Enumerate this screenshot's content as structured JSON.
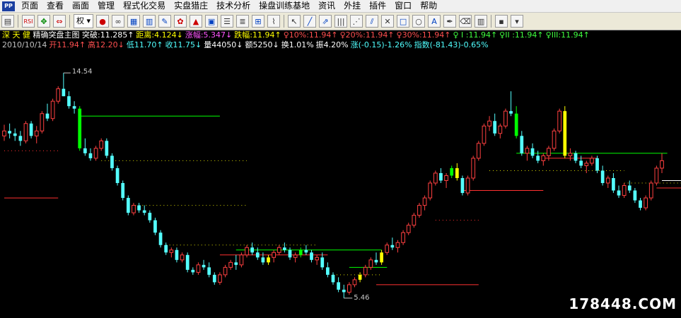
{
  "menubar": {
    "logo_text": "PP",
    "items": [
      "页面",
      "查看",
      "画面",
      "管理",
      "程式化交易",
      "实盘猎庄",
      "技术分析",
      "操盘训练基地",
      "资讯",
      "外挂",
      "插件",
      "窗口",
      "帮助"
    ]
  },
  "toolbar": {
    "period_select": "权",
    "icons": [
      "folder-icon",
      "rsi-icon",
      "move-icon",
      "arrows-icon",
      "period-select",
      "circle-icon",
      "glasses-icon",
      "doc-icon",
      "book-icon",
      "pen-icon",
      "brush-icon",
      "bell-icon",
      "box-icon",
      "menu-icon",
      "list-icon",
      "grid-icon",
      "chart-icon",
      "cursor-icon",
      "line-icon",
      "trend-icon",
      "bars-icon",
      "fan-icon",
      "channel-icon",
      "cross-icon",
      "rect-icon",
      "ellipse-icon",
      "text-icon",
      "marker-icon",
      "eraser-icon",
      "bars2-icon",
      "save-icon",
      "dropdown-icon"
    ]
  },
  "stock": {
    "name": "深 天 健",
    "indicator": "精确突盘主图",
    "line1": [
      {
        "text": "突破:11.285↑",
        "color": "w"
      },
      {
        "text": "距离:4.124↓",
        "color": "y"
      },
      {
        "text": "涨幅:5.347↓",
        "color": "m"
      },
      {
        "text": "跌幅:11.94↑",
        "color": "y"
      },
      {
        "text": "♀10%:11.94↑",
        "color": "r"
      },
      {
        "text": "♀20%:11.94↑",
        "color": "r"
      },
      {
        "text": "♀30%:11.94↑",
        "color": "r"
      },
      {
        "text": "♀ I :11.94↑",
        "color": "g"
      },
      {
        "text": "♀II :11.94↑",
        "color": "g"
      },
      {
        "text": "♀III:11.94↑",
        "color": "g"
      }
    ],
    "line2": [
      {
        "text": "2010/10/14",
        "color": "gr"
      },
      {
        "text": "开11.94↑",
        "color": "r"
      },
      {
        "text": "高12.20↓",
        "color": "r"
      },
      {
        "text": "低11.70↑",
        "color": "c"
      },
      {
        "text": "收11.75↓",
        "color": "c"
      },
      {
        "text": "量44050↓",
        "color": "w"
      },
      {
        "text": "额5250↓",
        "color": "w"
      },
      {
        "text": "换1.01%",
        "color": "w"
      },
      {
        "text": "振4.20%",
        "color": "w"
      },
      {
        "text": "涨(-0.15)-1.26%",
        "color": "c"
      },
      {
        "text": "指数(-81.43)-0.65%",
        "color": "c"
      }
    ]
  },
  "chart": {
    "high_label": "14.54",
    "low_label": "5.46"
  },
  "chart_data": {
    "type": "candlestick",
    "ylim": [
      5.0,
      15.4
    ],
    "high_point": 14.54,
    "low_point": 5.46,
    "colors": {
      "up": "#ff4040",
      "down": "#54ffff",
      "signal_green": "#00ff00",
      "signal_yellow": "#ffff00"
    },
    "candles": [
      [
        12.0,
        12.45,
        11.8,
        12.2
      ],
      [
        12.2,
        12.5,
        11.9,
        12.1
      ],
      [
        12.1,
        12.3,
        11.8,
        12.0
      ],
      [
        12.0,
        12.2,
        11.6,
        11.8
      ],
      [
        11.8,
        12.6,
        11.7,
        12.5
      ],
      [
        12.5,
        12.6,
        11.9,
        12.0
      ],
      [
        12.0,
        12.4,
        11.7,
        12.2
      ],
      [
        12.2,
        13.0,
        12.1,
        12.9
      ],
      [
        12.9,
        13.3,
        12.6,
        12.7
      ],
      [
        12.7,
        13.5,
        12.6,
        13.4
      ],
      [
        13.4,
        14.0,
        13.3,
        13.9
      ],
      [
        13.9,
        14.54,
        13.6,
        13.6
      ],
      [
        13.6,
        13.8,
        13.1,
        13.2
      ],
      [
        13.2,
        13.4,
        12.9,
        13.1
      ],
      [
        13.1,
        13.2,
        11.4,
        11.5
      ],
      [
        11.5,
        11.9,
        11.2,
        11.3
      ],
      [
        11.3,
        11.5,
        11.0,
        11.1
      ],
      [
        11.1,
        11.6,
        11.0,
        11.5
      ],
      [
        11.5,
        11.9,
        11.4,
        11.8
      ],
      [
        11.8,
        11.9,
        11.1,
        11.2
      ],
      [
        11.2,
        11.3,
        10.6,
        10.7
      ],
      [
        10.7,
        10.8,
        10.0,
        10.1
      ],
      [
        10.1,
        10.2,
        9.4,
        9.5
      ],
      [
        9.5,
        9.6,
        8.8,
        8.9
      ],
      [
        8.9,
        9.3,
        8.8,
        9.2
      ],
      [
        9.2,
        9.3,
        8.9,
        9.0
      ],
      [
        9.0,
        9.2,
        8.8,
        8.9
      ],
      [
        8.9,
        9.0,
        8.5,
        8.6
      ],
      [
        8.6,
        8.7,
        8.0,
        8.1
      ],
      [
        8.1,
        8.2,
        7.5,
        7.6
      ],
      [
        7.6,
        7.7,
        7.2,
        7.3
      ],
      [
        7.3,
        7.5,
        7.1,
        7.4
      ],
      [
        7.4,
        7.5,
        6.9,
        7.0
      ],
      [
        7.0,
        7.3,
        6.9,
        7.2
      ],
      [
        7.2,
        7.3,
        6.5,
        6.6
      ],
      [
        6.6,
        6.7,
        6.4,
        6.5
      ],
      [
        6.5,
        6.9,
        6.4,
        6.8
      ],
      [
        6.8,
        7.0,
        6.6,
        6.7
      ],
      [
        6.7,
        6.9,
        6.3,
        6.4
      ],
      [
        6.4,
        6.5,
        6.0,
        6.1
      ],
      [
        6.1,
        6.5,
        6.0,
        6.4
      ],
      [
        6.4,
        6.8,
        6.3,
        6.7
      ],
      [
        6.7,
        7.0,
        6.6,
        6.9
      ],
      [
        6.9,
        7.2,
        6.6,
        6.8
      ],
      [
        6.8,
        7.3,
        6.7,
        7.2
      ],
      [
        7.2,
        7.6,
        7.1,
        7.5
      ],
      [
        7.5,
        7.7,
        7.2,
        7.3
      ],
      [
        7.3,
        7.5,
        7.0,
        7.1
      ],
      [
        7.1,
        7.3,
        6.8,
        6.9
      ],
      [
        6.9,
        7.2,
        6.8,
        7.1
      ],
      [
        7.1,
        7.4,
        6.9,
        7.3
      ],
      [
        7.3,
        7.6,
        7.2,
        7.5
      ],
      [
        7.5,
        7.7,
        7.3,
        7.4
      ],
      [
        7.4,
        7.5,
        7.0,
        7.1
      ],
      [
        7.1,
        7.3,
        6.9,
        7.2
      ],
      [
        7.2,
        7.5,
        7.1,
        7.4
      ],
      [
        7.4,
        7.6,
        7.2,
        7.3
      ],
      [
        7.3,
        7.4,
        6.9,
        7.0
      ],
      [
        7.0,
        7.2,
        6.8,
        7.1
      ],
      [
        7.1,
        7.3,
        6.6,
        6.7
      ],
      [
        6.7,
        6.9,
        6.3,
        6.4
      ],
      [
        6.4,
        6.5,
        6.0,
        6.1
      ],
      [
        6.1,
        6.3,
        5.7,
        5.8
      ],
      [
        5.8,
        6.0,
        5.46,
        5.7
      ],
      [
        5.7,
        6.1,
        5.6,
        6.0
      ],
      [
        6.0,
        6.3,
        5.9,
        6.2
      ],
      [
        6.2,
        6.5,
        6.1,
        6.4
      ],
      [
        6.4,
        6.8,
        6.3,
        6.7
      ],
      [
        6.7,
        7.1,
        6.6,
        7.0
      ],
      [
        7.0,
        7.3,
        6.8,
        6.9
      ],
      [
        6.9,
        7.4,
        6.8,
        7.3
      ],
      [
        7.3,
        7.7,
        7.2,
        7.6
      ],
      [
        7.6,
        7.9,
        7.4,
        7.5
      ],
      [
        7.5,
        7.8,
        7.3,
        7.7
      ],
      [
        7.7,
        8.2,
        7.6,
        8.1
      ],
      [
        8.1,
        8.5,
        8.0,
        8.4
      ],
      [
        8.4,
        8.9,
        8.3,
        8.8
      ],
      [
        8.8,
        9.3,
        8.7,
        9.2
      ],
      [
        9.2,
        9.6,
        9.0,
        9.5
      ],
      [
        9.5,
        10.2,
        9.4,
        10.1
      ],
      [
        10.1,
        10.6,
        10.0,
        10.5
      ],
      [
        10.5,
        10.7,
        10.1,
        10.2
      ],
      [
        10.2,
        10.5,
        9.9,
        10.4
      ],
      [
        10.4,
        10.8,
        10.3,
        10.7
      ],
      [
        10.7,
        10.9,
        10.2,
        10.3
      ],
      [
        10.3,
        10.4,
        9.6,
        9.7
      ],
      [
        9.7,
        10.4,
        9.6,
        10.3
      ],
      [
        10.3,
        11.2,
        10.2,
        11.1
      ],
      [
        11.1,
        11.8,
        11.0,
        11.7
      ],
      [
        11.7,
        12.5,
        11.6,
        12.4
      ],
      [
        12.4,
        12.8,
        12.2,
        12.6
      ],
      [
        12.6,
        12.9,
        12.0,
        12.1
      ],
      [
        12.1,
        12.5,
        11.9,
        12.4
      ],
      [
        12.4,
        13.1,
        12.3,
        13.0
      ],
      [
        13.0,
        13.8,
        12.8,
        12.9
      ],
      [
        12.9,
        13.2,
        11.9,
        12.0
      ],
      [
        12.0,
        12.2,
        11.2,
        11.3
      ],
      [
        11.3,
        11.6,
        11.0,
        11.5
      ],
      [
        11.5,
        11.7,
        11.1,
        11.2
      ],
      [
        11.2,
        11.4,
        10.9,
        11.0
      ],
      [
        11.0,
        11.3,
        10.8,
        11.2
      ],
      [
        11.2,
        11.6,
        11.0,
        11.5
      ],
      [
        11.5,
        12.3,
        11.4,
        12.2
      ],
      [
        12.2,
        13.1,
        12.1,
        13.0
      ],
      [
        13.0,
        13.2,
        11.1,
        11.2
      ],
      [
        11.2,
        11.5,
        11.0,
        11.3
      ],
      [
        11.3,
        11.4,
        10.9,
        11.0
      ],
      [
        11.0,
        11.2,
        10.7,
        10.8
      ],
      [
        10.8,
        11.0,
        10.5,
        10.9
      ],
      [
        10.9,
        11.2,
        10.8,
        11.1
      ],
      [
        11.1,
        11.2,
        10.5,
        10.6
      ],
      [
        10.6,
        10.8,
        10.0,
        10.1
      ],
      [
        10.1,
        10.4,
        9.9,
        10.3
      ],
      [
        10.3,
        10.5,
        9.7,
        9.8
      ],
      [
        9.8,
        10.0,
        9.5,
        9.6
      ],
      [
        9.6,
        10.1,
        9.5,
        10.0
      ],
      [
        10.0,
        10.2,
        9.7,
        9.8
      ],
      [
        9.8,
        9.9,
        9.3,
        9.4
      ],
      [
        9.4,
        9.5,
        9.0,
        9.1
      ],
      [
        9.1,
        9.6,
        9.0,
        9.5
      ],
      [
        9.5,
        10.2,
        9.4,
        10.1
      ],
      [
        10.1,
        10.8,
        10.0,
        10.7
      ],
      [
        10.7,
        11.3,
        10.5,
        11.0
      ]
    ],
    "signal_bars": [
      {
        "index": 14,
        "color": "green"
      },
      {
        "index": 49,
        "color": "yellow"
      },
      {
        "index": 55,
        "color": "green"
      },
      {
        "index": 66,
        "color": "yellow"
      },
      {
        "index": 70,
        "color": "yellow"
      },
      {
        "index": 83,
        "color": "green"
      },
      {
        "index": 84,
        "color": "yellow"
      },
      {
        "index": 95,
        "color": "green"
      },
      {
        "index": 104,
        "color": "yellow"
      },
      {
        "index": 125,
        "color": "yellow"
      }
    ],
    "level_lines": [
      {
        "value": 12.8,
        "from": 14,
        "to": 40,
        "color": "green",
        "style": "solid"
      },
      {
        "value": 11.4,
        "from": 0,
        "to": 10,
        "color": "red",
        "style": "dotted"
      },
      {
        "value": 11.0,
        "from": 18,
        "to": 45,
        "color": "yellow",
        "style": "dotted"
      },
      {
        "value": 9.5,
        "from": 0,
        "to": 10,
        "color": "red",
        "style": "solid"
      },
      {
        "value": 9.2,
        "from": 23,
        "to": 45,
        "color": "yellow",
        "style": "dotted"
      },
      {
        "value": 7.6,
        "from": 30,
        "to": 58,
        "color": "yellow",
        "style": "dotted"
      },
      {
        "value": 7.4,
        "from": 43,
        "to": 70,
        "color": "green",
        "style": "solid"
      },
      {
        "value": 7.2,
        "from": 40,
        "to": 60,
        "color": "red",
        "style": "solid"
      },
      {
        "value": 6.4,
        "from": 61,
        "to": 70,
        "color": "yellow",
        "style": "dotted"
      },
      {
        "value": 6.7,
        "from": 64,
        "to": 71,
        "color": "green",
        "style": "solid"
      },
      {
        "value": 6.0,
        "from": 69,
        "to": 88,
        "color": "red",
        "style": "solid"
      },
      {
        "value": 8.6,
        "from": 80,
        "to": 88,
        "color": "red",
        "style": "dotted"
      },
      {
        "value": 9.8,
        "from": 85,
        "to": 100,
        "color": "red",
        "style": "solid"
      },
      {
        "value": 10.6,
        "from": 90,
        "to": 115,
        "color": "yellow",
        "style": "dotted"
      },
      {
        "value": 11.3,
        "from": 95,
        "to": 123,
        "color": "green",
        "style": "solid"
      },
      {
        "value": 11.1,
        "from": 100,
        "to": 110,
        "color": "red",
        "style": "solid"
      },
      {
        "value": 10.1,
        "from": 115,
        "to": 127,
        "color": "yellow",
        "style": "dotted"
      },
      {
        "value": 9.9,
        "from": 121,
        "to": 127,
        "color": "red",
        "style": "solid"
      },
      {
        "value": 10.2,
        "from": 122,
        "to": 127,
        "color": "white",
        "style": "solid"
      }
    ]
  },
  "watermark": "178448.COM"
}
